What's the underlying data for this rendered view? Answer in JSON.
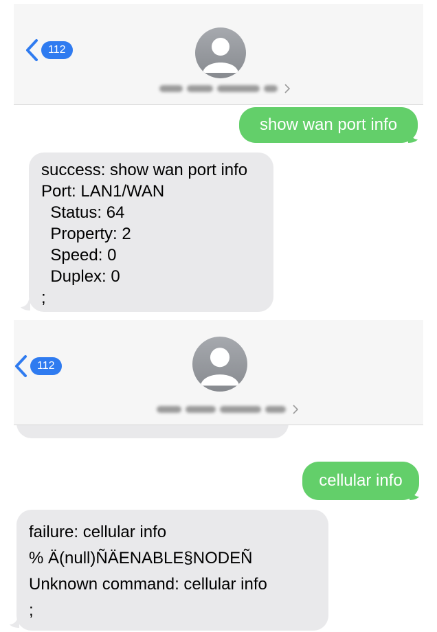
{
  "screen1": {
    "header": {
      "back_badge": "112",
      "back_icon": "chevron-left-icon",
      "avatar_icon": "person-silhouette-icon",
      "contact_name_blurred": true
    },
    "messages": [
      {
        "direction": "sent",
        "text": "show wan port info"
      },
      {
        "direction": "received",
        "text": "success: show wan port info\nPort: LAN1/WAN\n  Status: 64\n  Property: 2\n  Speed: 0\n  Duplex: 0\n;"
      }
    ]
  },
  "screen2": {
    "header": {
      "back_badge": "112",
      "back_icon": "chevron-left-icon",
      "avatar_icon": "person-silhouette-icon",
      "contact_name_blurred": true
    },
    "partial_previous_text": ";",
    "messages": [
      {
        "direction": "sent",
        "text": "cellular info"
      },
      {
        "direction": "received",
        "text": "failure: cellular info\n% Ä(null)ÑÄENABLE§NODEÑ\nUnknown command: cellular info\n;"
      }
    ]
  },
  "colors": {
    "badge": "#2f7bf0",
    "sent_bubble": "#63cf6a",
    "received_bubble": "#e9e9eb",
    "header_background": "#f6f6f6"
  }
}
